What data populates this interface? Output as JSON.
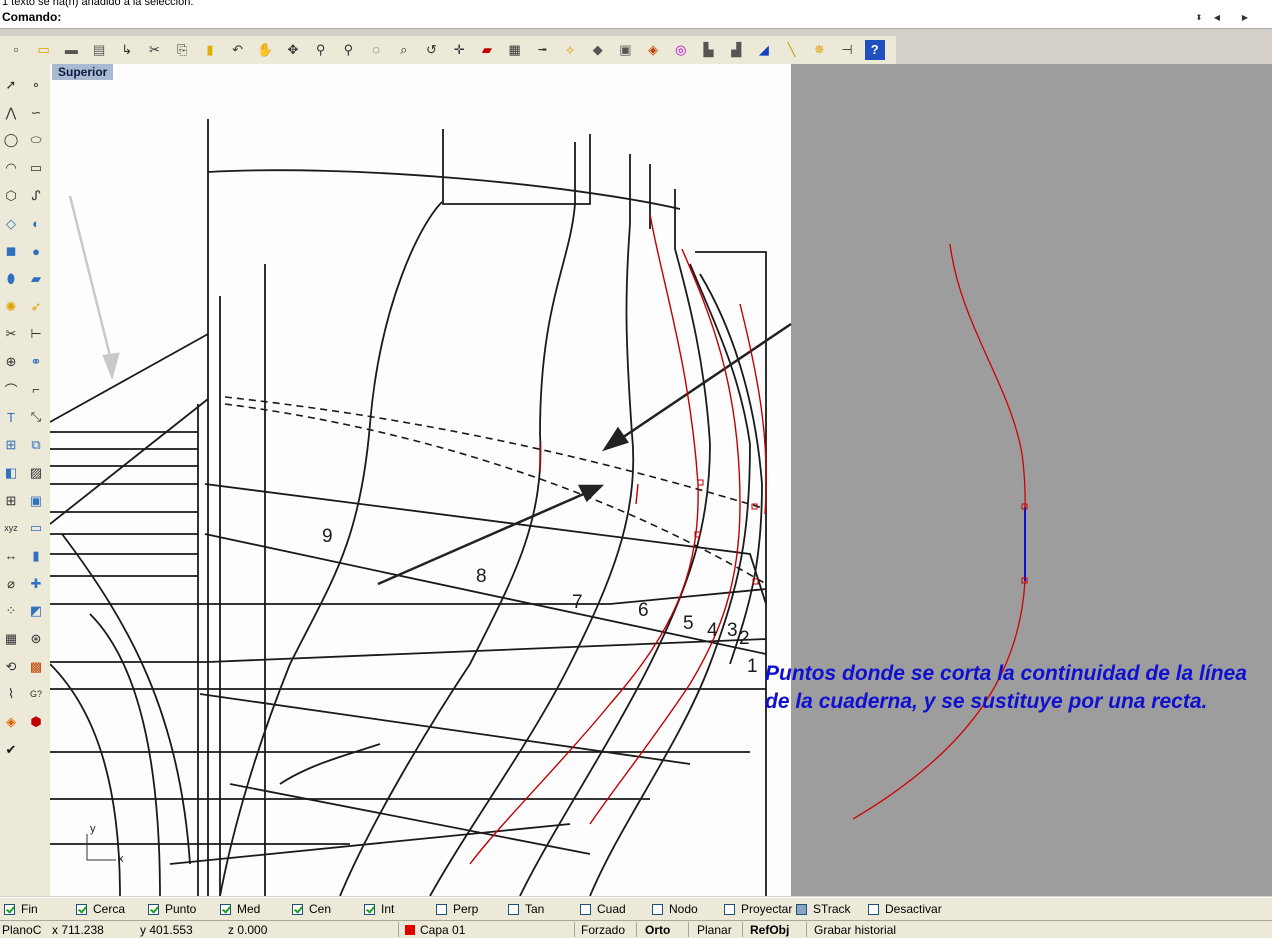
{
  "history": {
    "text": "1 texto se ha(n) añadido a la selección."
  },
  "command": {
    "label": "Comando:",
    "value": ""
  },
  "viewport": {
    "title": "Superior",
    "annotation": "Puntos donde se corta la continuidad de la línea de la cuaderna, y se sustituye por una recta.",
    "station_labels": [
      "9",
      "8",
      "7",
      "6",
      "5",
      "4",
      "3",
      "2",
      "1"
    ],
    "axis_x": "x",
    "axis_y": "y",
    "background_color": "#9d9d9d",
    "curve_color": "#e00000",
    "annotation_color": "#1010d0"
  },
  "toolbar": {
    "icons": [
      "new-document-icon",
      "open-folder-icon",
      "save-icon",
      "print-icon",
      "import-icon",
      "cut-icon",
      "copy-icon",
      "paste-icon",
      "undo-icon",
      "pan-icon",
      "rotate-view-icon",
      "zoom-icon",
      "zoom-window-icon",
      "zoom-extents-icon",
      "zoom-selected-icon",
      "undo-view-icon",
      "move-icon",
      "car-icon",
      "grid-icon",
      "point-snap-icon",
      "select-icon",
      "layer-icon",
      "print-setup-icon",
      "object-properties-icon",
      "color-icon",
      "render-icon",
      "material-icon",
      "sphere-render-icon",
      "light-icon",
      "gear-tools-icon",
      "dimension-icon",
      "help-icon"
    ]
  },
  "palette": {
    "icons": [
      "select-arrow-icon",
      "point-icon",
      "polyline-icon",
      "curve-icon",
      "circle-icon",
      "ellipse-icon",
      "arc-icon",
      "rectangle-icon",
      "polygon-icon",
      "free-curve-icon",
      "surface-icon",
      "loft-icon",
      "box-icon",
      "sphere-icon",
      "cylinder-icon",
      "plane-surface-icon",
      "explode-icon",
      "extend-icon",
      "trim-icon",
      "split-icon",
      "join-icon",
      "boolean-icon",
      "fillet-icon",
      "chamfer-icon",
      "text-icon",
      "scale-icon",
      "array-icon",
      "mirror-icon",
      "solid-icon",
      "hatch-icon",
      "grid-snap-icon",
      "viewport-icon",
      "xyz-icon",
      "cplane-icon",
      "dimension-linear-icon",
      "named-view-icon",
      "dimension-radius-icon",
      "four-view-icon",
      "point-cloud-icon",
      "shade-icon",
      "layout-icon",
      "gumball-icon",
      "history-icon",
      "render-preview-icon",
      "analyze-icon",
      "curvature-icon",
      "rainbow-icon",
      "cube-icon",
      "check-icon"
    ]
  },
  "osnap": {
    "items": [
      {
        "label": "Fin",
        "checked": true
      },
      {
        "label": "Cerca",
        "checked": true
      },
      {
        "label": "Punto",
        "checked": true
      },
      {
        "label": "Med",
        "checked": true
      },
      {
        "label": "Cen",
        "checked": true
      },
      {
        "label": "Int",
        "checked": true
      },
      {
        "label": "Perp",
        "checked": false
      },
      {
        "label": "Tan",
        "checked": false
      },
      {
        "label": "Cuad",
        "checked": false
      },
      {
        "label": "Nodo",
        "checked": false
      },
      {
        "label": "Proyectar",
        "checked": false
      },
      {
        "label": "STrack",
        "checked": false
      },
      {
        "label": "Desactivar",
        "checked": false
      }
    ]
  },
  "status": {
    "cplane": "PlanoC",
    "x": "x 711.238",
    "y": "y 401.553",
    "z": "z 0.000",
    "layer": "Capa 01",
    "layer_color": "#e00000",
    "forzado": "Forzado",
    "orto": "Orto",
    "planar": "Planar",
    "refobj": "RefObj",
    "history": "Grabar historial"
  }
}
